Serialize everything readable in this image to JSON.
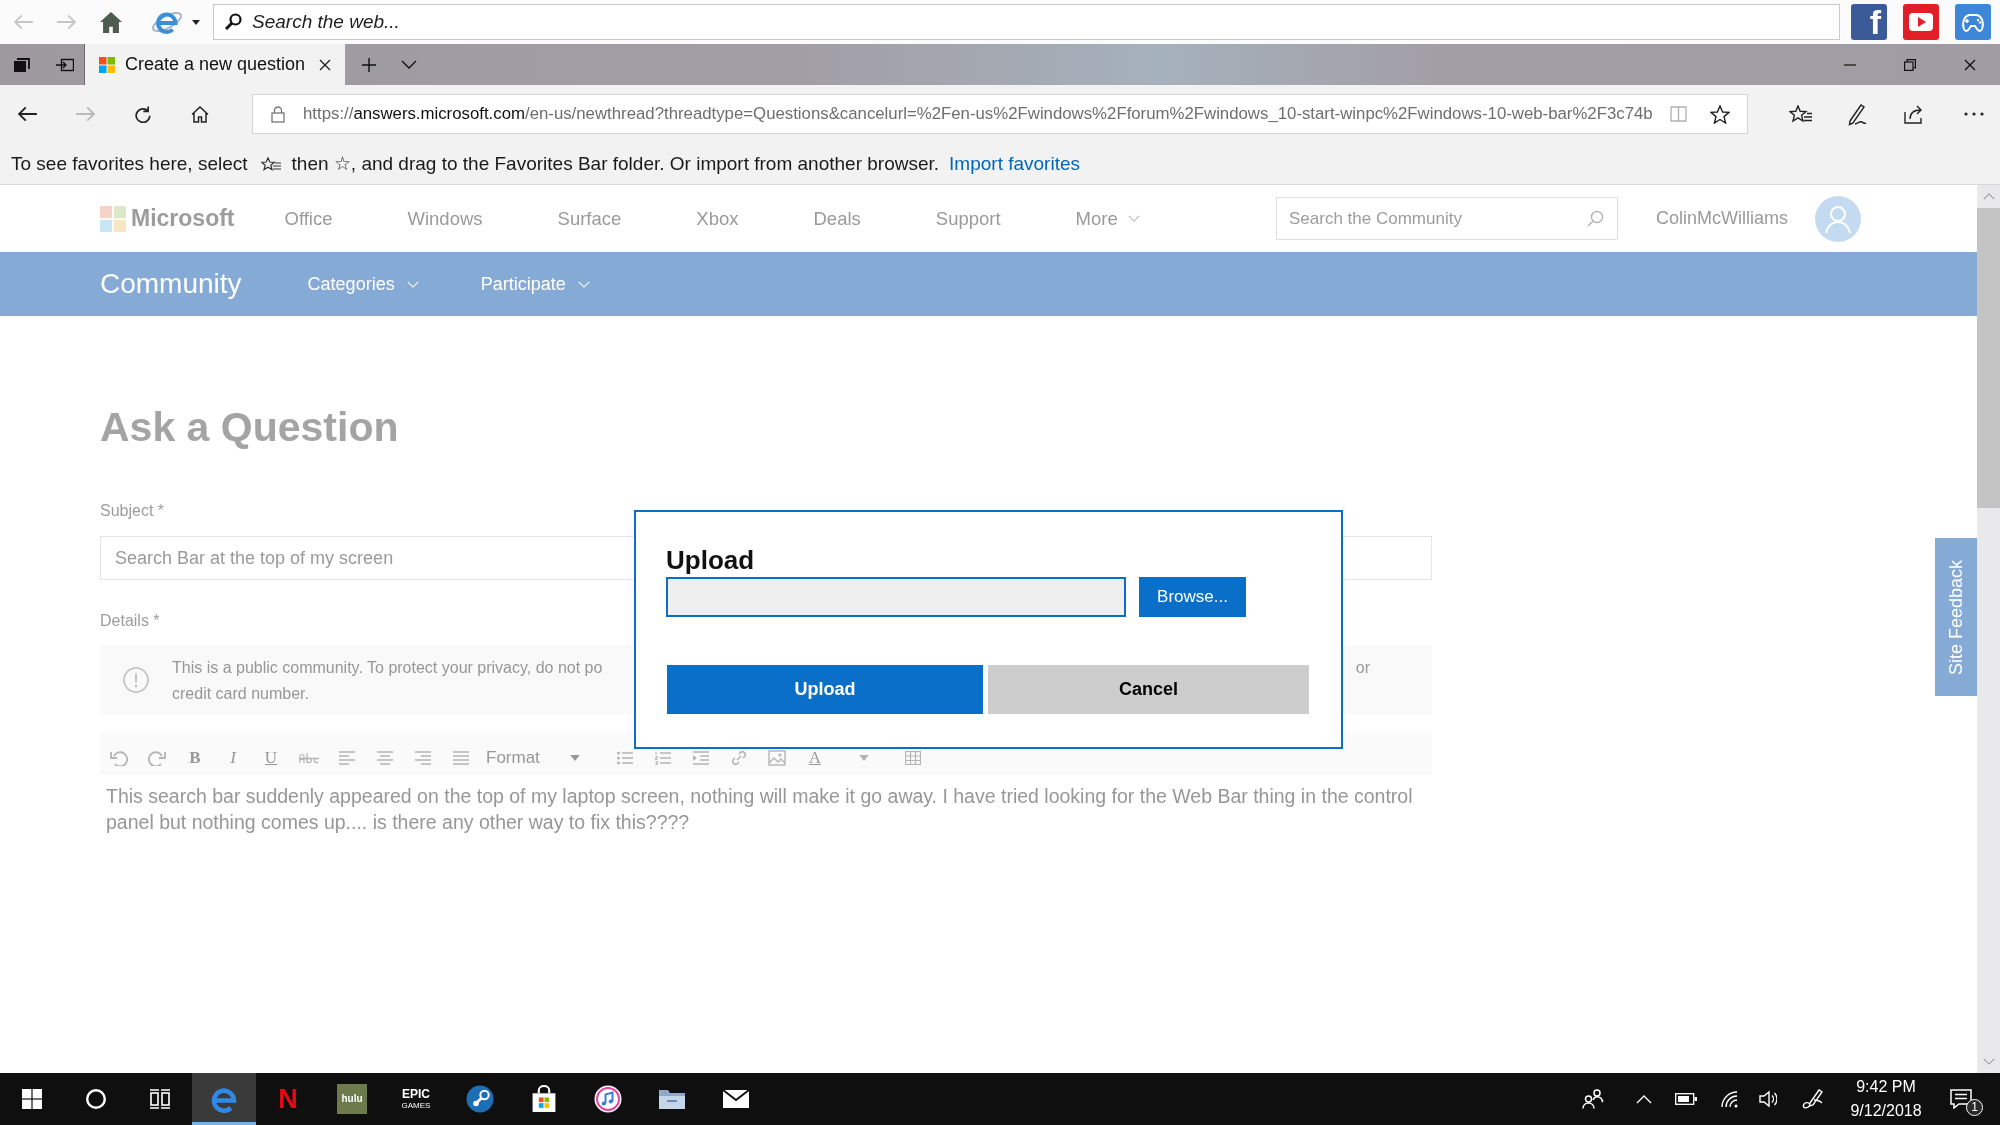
{
  "web_bar": {
    "back": {
      "disabled": true
    },
    "forward": {
      "disabled": true
    },
    "search": {
      "placeholder": "Search the web..."
    },
    "shortcuts": [
      {
        "kind": "letter",
        "label": "f"
      },
      {
        "kind": "play"
      },
      {
        "kind": "gamepad"
      }
    ]
  },
  "tab_bar": {
    "tabs": [
      {
        "title": "Create a new question",
        "selected": true
      }
    ]
  },
  "address_bar": {
    "back": {
      "disabled": false
    },
    "forward": {
      "disabled": true
    },
    "url": {
      "scheme": "https://",
      "domain": "answers.microsoft.com",
      "path": "/en-us/newthread?threadtype=Questions&cancelurl=%2Fen-us%2Fwindows%2Fforum%2Fwindows_10-start-winpc%2Fwindows-10-web-bar%2F3c74b"
    }
  },
  "favorites_bar": {
    "text_before": "To see favorites here, select",
    "text_after": "then ☆, and drag to the Favorites Bar folder. Or import from another browser.",
    "link": "Import favorites"
  },
  "site_header": {
    "logo": "Microsoft",
    "nav": [
      "Office",
      "Windows",
      "Surface",
      "Xbox",
      "Deals",
      "Support"
    ],
    "more": "More",
    "search": {
      "placeholder": "Search the Community"
    },
    "user": "ColinMcWilliams"
  },
  "community_bar": {
    "title": "Community",
    "menus": [
      "Categories",
      "Participate"
    ]
  },
  "form": {
    "heading": "Ask a Question",
    "subject": {
      "label": "Subject *",
      "value": "Search Bar at the top of my screen"
    },
    "details": {
      "label": "Details *"
    },
    "notice": {
      "line_1_start": "This is a public community. To protect your privacy, do not po",
      "line_1_end": "or",
      "line_2": "credit card number."
    },
    "editor": {
      "letters": [
        "B",
        "I",
        "U"
      ],
      "format": "Format",
      "color_letter": "A",
      "body": "This search bar suddenly appeared on the top of my laptop screen, nothing will make it go away. I have tried looking for the Web Bar thing in the control panel but nothing comes up.... is there any other way to fix this????"
    }
  },
  "site_feedback": "Site Feedback",
  "dialog": {
    "title": "Upload",
    "file_field": {
      "focused": true
    },
    "browse": "Browse...",
    "buttons": [
      {
        "label": "Upload",
        "kind": "primary"
      },
      {
        "label": "Cancel",
        "kind": "secondary"
      }
    ]
  },
  "taskbar": {
    "apps": [
      {
        "kind": "swirl",
        "selected": true
      },
      {
        "kind": "letter",
        "label": "N",
        "selected": false
      },
      {
        "kind": "tile",
        "label": "hulu",
        "selected": false
      },
      {
        "kind": "wordmark",
        "label": "EPIC",
        "sublabel": "GAMES",
        "selected": false
      },
      {
        "kind": "disc",
        "selected": false
      },
      {
        "kind": "bag",
        "selected": false
      },
      {
        "kind": "note",
        "selected": false
      },
      {
        "kind": "folder",
        "selected": false
      },
      {
        "kind": "envelope",
        "selected": false
      }
    ],
    "clock": {
      "time": "9:42 PM",
      "date": "9/12/2018"
    },
    "notifications": "1"
  }
}
